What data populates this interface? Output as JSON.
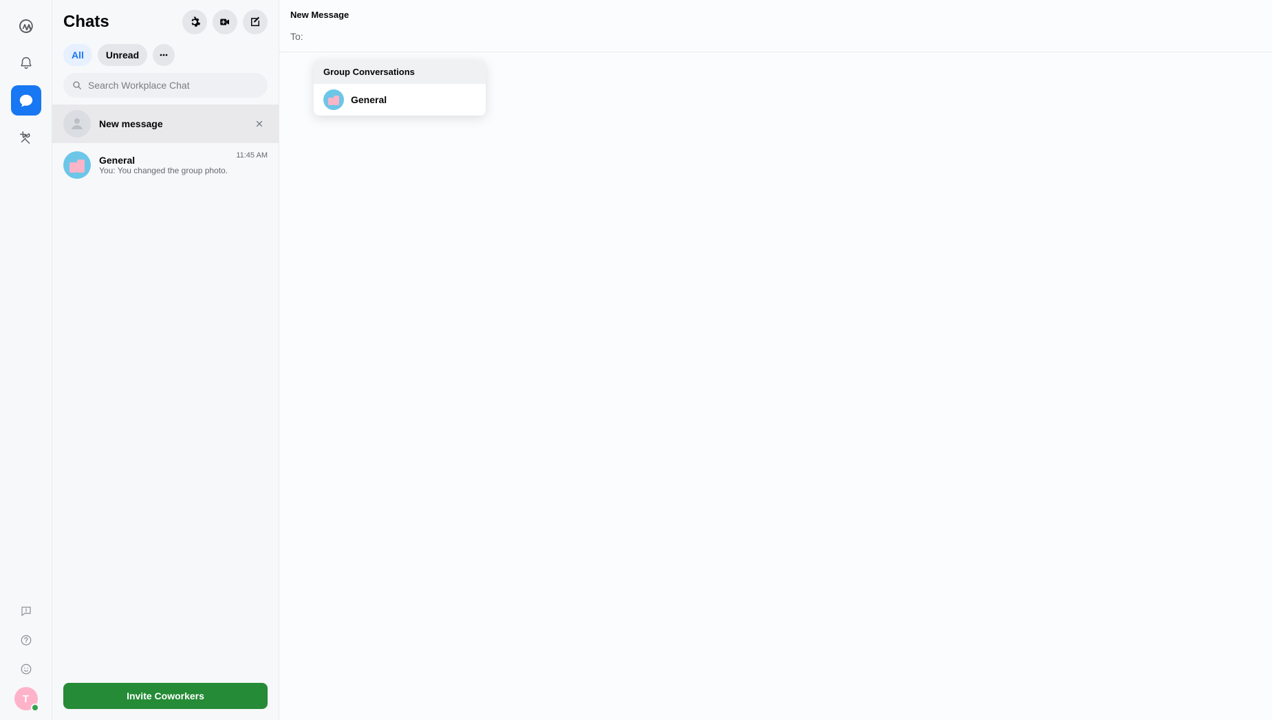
{
  "nav": {
    "avatar_initial": "T"
  },
  "list": {
    "title": "Chats",
    "filters": {
      "all": "All",
      "unread": "Unread"
    },
    "search_placeholder": "Search Workplace Chat",
    "new_message_label": "New message",
    "items": [
      {
        "name": "General",
        "snippet": "You: You changed the group photo.",
        "time": "11:45 AM"
      }
    ],
    "invite_label": "Invite Coworkers"
  },
  "main": {
    "title": "New Message",
    "to_label": "To:",
    "dropdown": {
      "header": "Group Conversations",
      "items": [
        {
          "name": "General"
        }
      ]
    }
  }
}
